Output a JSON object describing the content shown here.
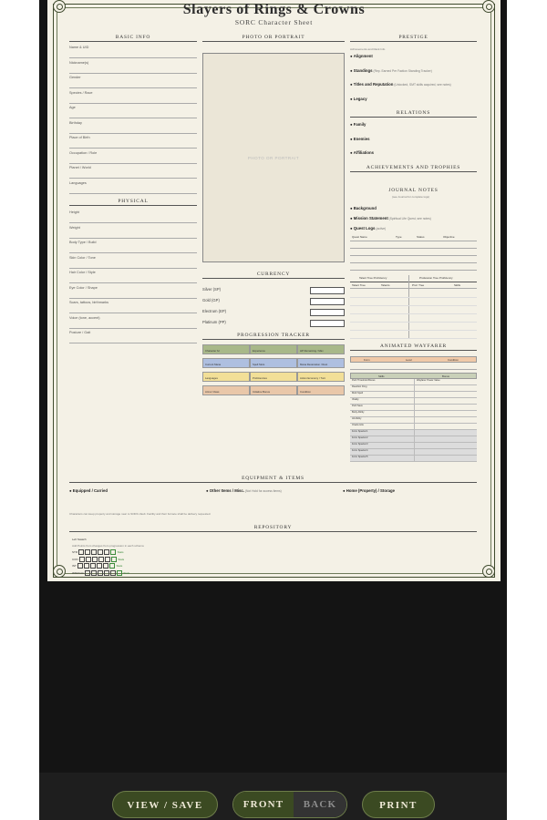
{
  "sheet": {
    "title": "Slayers of Rings & Crowns",
    "subtitle": "SORC Character Sheet",
    "sections": {
      "basic_info": "BASIC INFO",
      "physical": "PHYSICAL",
      "photo": "PHOTO OR PORTRAIT",
      "currency": "CURRENCY",
      "progression": "PROGRESSION TRACKER",
      "prestige": "PRESTIGE",
      "relations": "RELATIONS",
      "achievements": "ACHIEVEMENTS AND TROPHIES",
      "journal": "JOURNAL NOTES",
      "wayfarer": "ANIMATED WAYFARER",
      "equipment": "EQUIPMENT & ITEMS",
      "repository": "REPOSITORY"
    },
    "basic_fields": [
      "Name & UID",
      "Nickname(s)",
      "Gender",
      "Species / Race",
      "Age",
      "Birthday",
      "Place of Birth",
      "Occupation / Role",
      "Planet / World",
      "Languages"
    ],
    "physical_fields": [
      "Height",
      "Weight",
      "Body Type / Build",
      "Skin Color / Tone",
      "Hair Color / Style",
      "Eye Color / Shape",
      "Scars, tattoos, birthmarks",
      "Voice (tone, accent)",
      "Posture / Gait"
    ],
    "photo_placeholder": "PHOTO OR PORTRAIT",
    "currency": [
      "Silver (SP)",
      "Gold (GP)",
      "Electrum (EP)",
      "Platinum (PP)"
    ],
    "tracker": [
      [
        "Character lvl",
        "Experience",
        "HP Remaining / Max"
      ],
      [
        "Current Mana",
        "Spell Slots",
        "Mana Restoration / Rest"
      ],
      [
        "Languages",
        "Proficiencies",
        "Action Economy / Turn"
      ],
      [
        "Armor Class",
        "Initiative Bonus",
        "Condition"
      ]
    ],
    "prestige_note": "Achievements and Rank Info",
    "prestige_items": [
      {
        "label": "Alignment",
        "note": ""
      },
      {
        "label": "Standings",
        "note": "(Rep. Earned Per Faction Standing Tracker)"
      },
      {
        "label": "Titles and Reputation",
        "note": "(Unlocked, SMT skills acquired, see notes)"
      },
      {
        "label": "Legacy",
        "note": ""
      }
    ],
    "relations_items": [
      "Family",
      "Enemies",
      "Affiliations"
    ],
    "journal_note": "(see Journal for complete logs)",
    "journal_items": [
      {
        "label": "Background",
        "note": ""
      },
      {
        "label": "Mission Statement",
        "note": "(Spiritual Life Quest, see notes)"
      },
      {
        "label": "Quest Logs",
        "note": "(active)"
      }
    ],
    "quest_cols": [
      "Quest Name",
      "Type",
      "Status",
      "Objective"
    ],
    "prof_headers": [
      "Talent Tree Proficiency",
      "Profession Tree Proficiency"
    ],
    "prof_cols": [
      "Talent Tree",
      "Talents",
      "Prof. Tree",
      "Skills"
    ],
    "wayfarer_top": [
      "Form",
      "Level",
      "Condition"
    ],
    "wayfarer_cols": [
      "Skills",
      "Bonus"
    ],
    "wayfarer_rows": [
      "Peril Threshold Bonus",
      "Reaction Dmg",
      "Multi Spell",
      "Vitality",
      "Peril Save",
      "Body Ability",
      "All Ability",
      "Oracle Hits",
      "Form Special 1",
      "Form Special 2",
      "Form Special 3",
      "Form Special 4",
      "Form Special 5"
    ],
    "wayfarer_bonus_first": "Wayfarer Power Value",
    "equipment_items": [
      {
        "label": "Equipped / Carried",
        "note": ""
      },
      {
        "label": "Other Items / Misc.",
        "note": "(Not Hold for access items)"
      },
      {
        "label": "Home (Property) / Storage",
        "note": ""
      }
    ],
    "equipment_note": "Characters can keep property and storage near to SORC-Vault. Facility and their furnace shall be delivery requested.",
    "repository_head": "Left Swatch",
    "repository_sub": "Add Points from changes from progression in each schema",
    "repository_rows": [
      {
        "label": "STR",
        "tag": "Stats"
      },
      {
        "label": "CON",
        "tag": "Stats"
      },
      {
        "label": "INT",
        "tag": "Stats"
      },
      {
        "label": "WIS/CHA",
        "tag": "Stats"
      }
    ]
  },
  "controls": {
    "view_save": "VIEW / SAVE",
    "front": "FRONT",
    "back": "BACK",
    "print": "PRINT"
  },
  "colors": {
    "paper": "#f4f1e6",
    "ink": "#3f4a2e",
    "button": "#3b4a22",
    "tracker_row1": "#a8b889",
    "tracker_row2": "#aebfe0",
    "tracker_row3": "#f2df97",
    "tracker_row4": "#e9c7a9",
    "wayfarer_header": "#f0c9a8",
    "wayfarer_special": "#dcdcdc"
  }
}
